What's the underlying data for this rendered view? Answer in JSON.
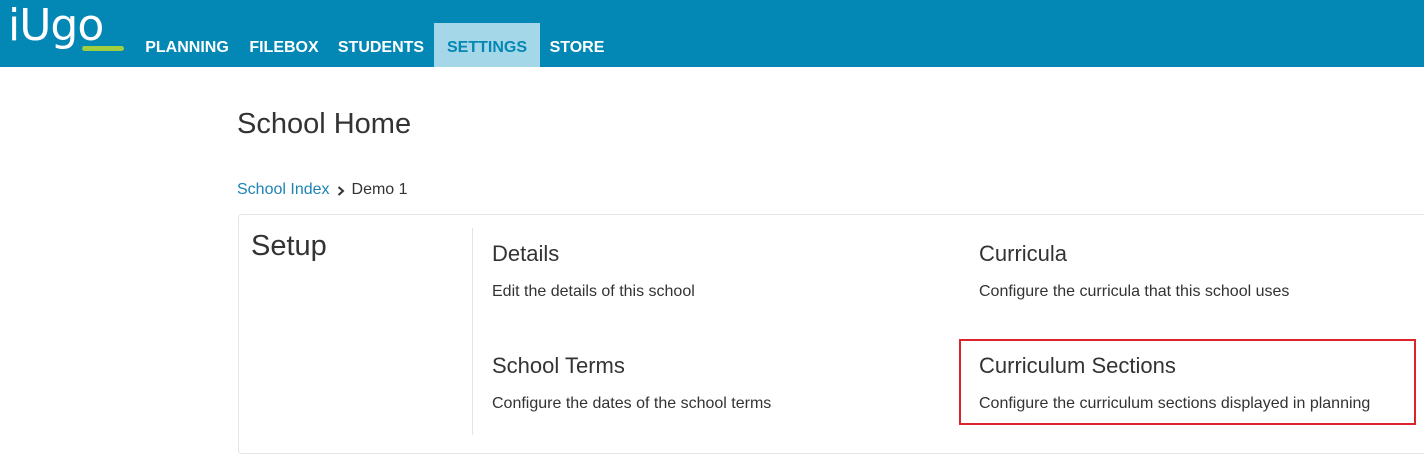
{
  "brand": {
    "logo_text": "iUgo"
  },
  "nav": {
    "items": [
      {
        "label": "PLANNING"
      },
      {
        "label": "FILEBOX"
      },
      {
        "label": "STUDENTS"
      },
      {
        "label": "SETTINGS",
        "active": true
      },
      {
        "label": "STORE"
      }
    ]
  },
  "page": {
    "title": "School Home"
  },
  "breadcrumb": {
    "parent": "School Index",
    "current": "Demo 1"
  },
  "setup": {
    "title": "Setup",
    "cards": [
      {
        "title": "Details",
        "description": "Edit the details of this school"
      },
      {
        "title": "Curricula",
        "description": "Configure the curricula that this school uses"
      },
      {
        "title": "School Terms",
        "description": "Configure the dates of the school terms"
      },
      {
        "title": "Curriculum Sections",
        "description": "Configure the curriculum sections displayed in planning",
        "highlighted": true
      }
    ]
  },
  "colors": {
    "navbar": "#0387b5",
    "nav_active_bg": "#a4d7e8",
    "link": "#1c83b5",
    "highlight": "#d9252b",
    "logo_accent": "#9fcf3f"
  }
}
